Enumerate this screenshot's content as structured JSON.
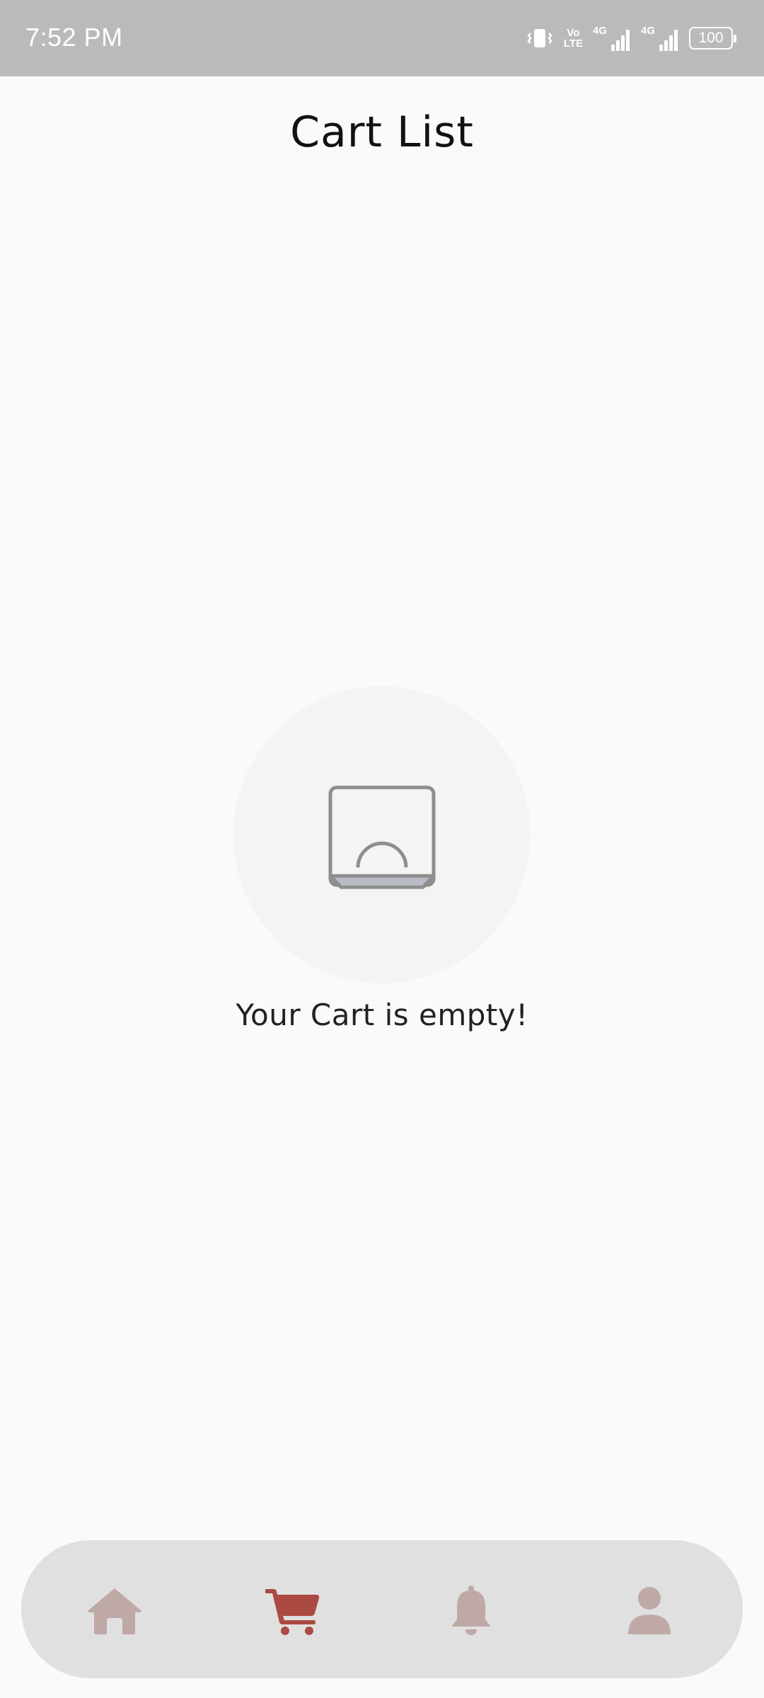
{
  "status_bar": {
    "time": "7:52 PM",
    "network_type_1": "4G",
    "network_type_2": "4G",
    "volte_top": "Vo",
    "volte_bottom": "LTE",
    "battery": "100",
    "icons": [
      "vibrate-icon",
      "volte-icon",
      "signal-icon",
      "signal-icon",
      "battery-icon"
    ]
  },
  "header": {
    "title": "Cart List"
  },
  "empty_state": {
    "message": "Your Cart is empty!",
    "icon": "empty-box-icon"
  },
  "bottom_nav": {
    "items": [
      {
        "name": "home",
        "icon": "home-icon",
        "active": false
      },
      {
        "name": "cart",
        "icon": "cart-icon",
        "active": true
      },
      {
        "name": "notifications",
        "icon": "bell-icon",
        "active": false
      },
      {
        "name": "profile",
        "icon": "person-icon",
        "active": false
      }
    ],
    "active_color": "#ab4a40",
    "inactive_color": "#bfa9a6",
    "background": "#e0e0e0"
  },
  "colors": {
    "background": "#fafafa",
    "status_bar": "#bababa",
    "title_text": "#111111",
    "body_text": "#222222"
  }
}
